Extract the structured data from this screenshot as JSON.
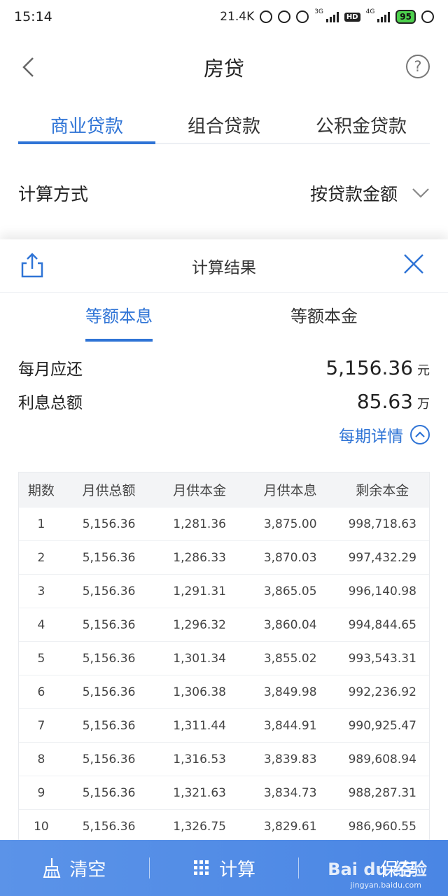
{
  "status": {
    "time": "15:14",
    "speed": "21.4K",
    "net1": "3G",
    "hd": "HD",
    "net2": "4G",
    "battery": "95"
  },
  "nav": {
    "title": "房贷"
  },
  "tabs": [
    {
      "label": "商业贷款",
      "active": true
    },
    {
      "label": "组合贷款",
      "active": false
    },
    {
      "label": "公积金贷款",
      "active": false
    }
  ],
  "calc": {
    "label": "计算方式",
    "value": "按贷款金额"
  },
  "sheet": {
    "title": "计算结果",
    "subtabs": [
      {
        "label": "等额本息",
        "active": true
      },
      {
        "label": "等额本金",
        "active": false
      }
    ],
    "monthly": {
      "label": "每月应还",
      "value": "5,156.36",
      "unit": "元"
    },
    "interest": {
      "label": "利息总额",
      "value": "85.63",
      "unit": "万"
    },
    "detail_label": "每期详情"
  },
  "table": {
    "headers": [
      "期数",
      "月供总额",
      "月供本金",
      "月供本息",
      "剩余本金"
    ],
    "rows": [
      [
        "1",
        "5,156.36",
        "1,281.36",
        "3,875.00",
        "998,718.63"
      ],
      [
        "2",
        "5,156.36",
        "1,286.33",
        "3,870.03",
        "997,432.29"
      ],
      [
        "3",
        "5,156.36",
        "1,291.31",
        "3,865.05",
        "996,140.98"
      ],
      [
        "4",
        "5,156.36",
        "1,296.32",
        "3,860.04",
        "994,844.65"
      ],
      [
        "5",
        "5,156.36",
        "1,301.34",
        "3,855.02",
        "993,543.31"
      ],
      [
        "6",
        "5,156.36",
        "1,306.38",
        "3,849.98",
        "992,236.92"
      ],
      [
        "7",
        "5,156.36",
        "1,311.44",
        "3,844.91",
        "990,925.47"
      ],
      [
        "8",
        "5,156.36",
        "1,316.53",
        "3,839.83",
        "989,608.94"
      ],
      [
        "9",
        "5,156.36",
        "1,321.63",
        "3,834.73",
        "988,287.31"
      ],
      [
        "10",
        "5,156.36",
        "1,326.75",
        "3,829.61",
        "986,960.55"
      ]
    ]
  },
  "bottom": {
    "clear": "清空",
    "calculate": "计算",
    "save": "保存"
  },
  "watermark": {
    "text": "Bai du 经验",
    "sub": "jingyan.baidu.com"
  },
  "colors": {
    "accent": "#2f74d6",
    "bottom_bar": "#4a86e4"
  }
}
